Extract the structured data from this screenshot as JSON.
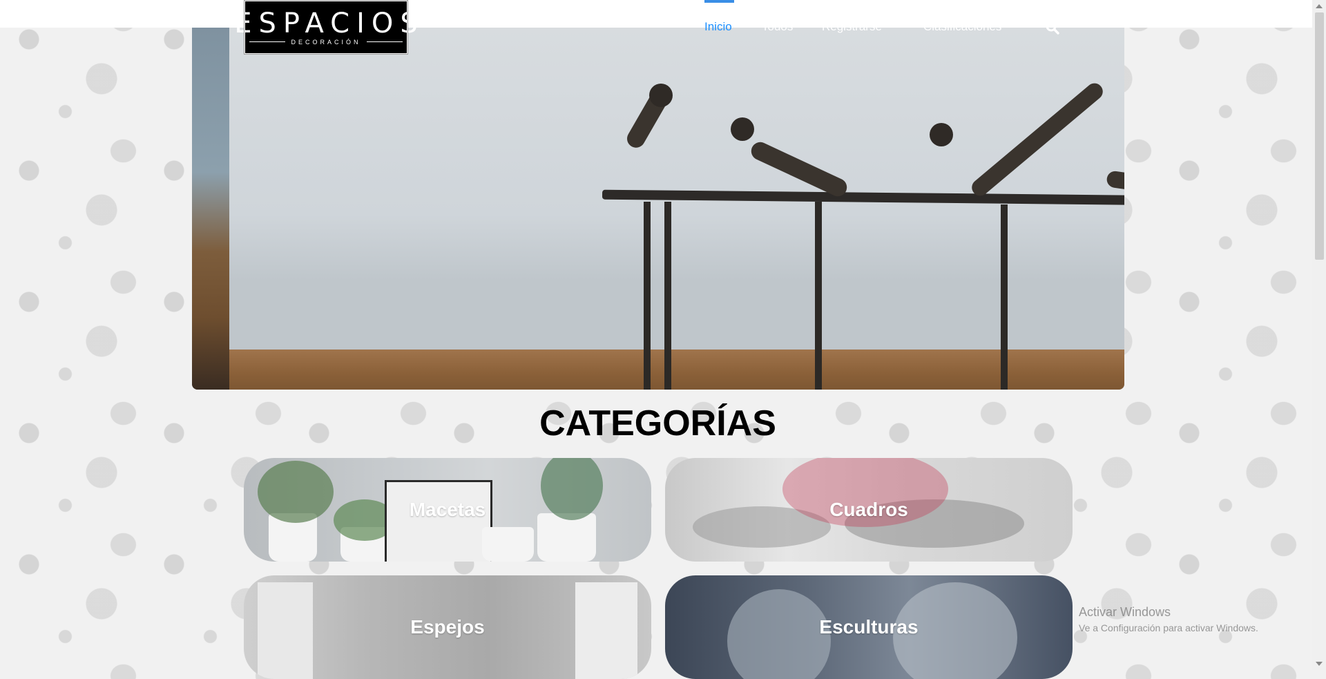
{
  "brand": {
    "logo_main": "ESPACIOS",
    "logo_sub": "DECORACIÓN"
  },
  "nav": {
    "items": [
      {
        "label": "Inicio",
        "active": true
      },
      {
        "label": "Todos",
        "active": false
      },
      {
        "label": "Registrarse",
        "active": false
      },
      {
        "label": "Clasificaciones",
        "active": false
      }
    ],
    "search_icon": "search-icon",
    "active_color": "#1e90ff"
  },
  "slider": {
    "dot_count": 3,
    "active_index": 0
  },
  "categories": {
    "title": "CATEGORÍAS",
    "items": [
      {
        "label": "Macetas"
      },
      {
        "label": "Cuadros"
      },
      {
        "label": "Espejos"
      },
      {
        "label": "Esculturas"
      }
    ]
  },
  "os_watermark": {
    "title": "Activar Windows",
    "subtitle": "Ve a Configuración para activar Windows."
  }
}
